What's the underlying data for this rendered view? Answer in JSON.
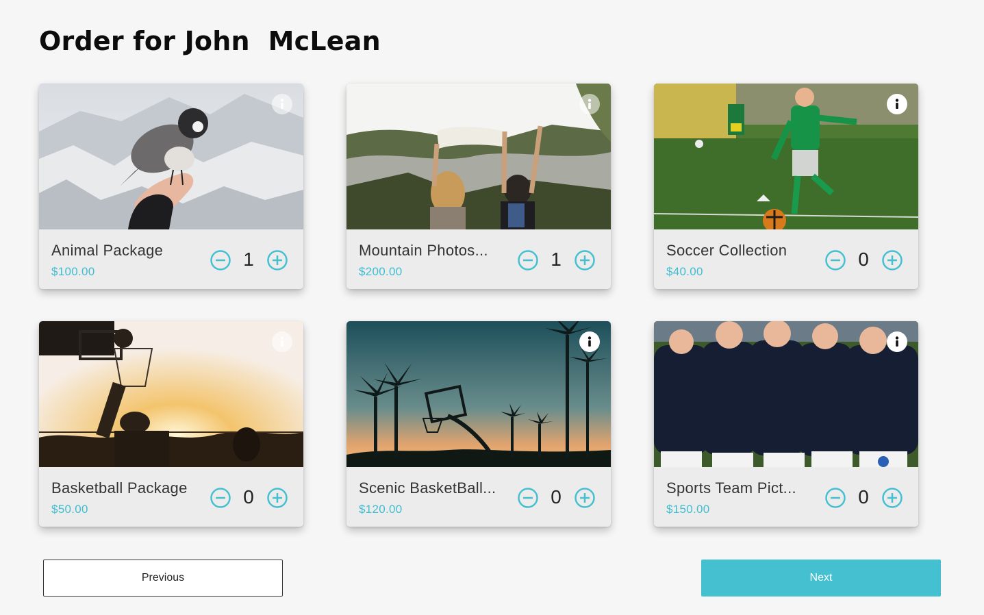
{
  "page": {
    "title": "Order for John  McLean"
  },
  "accent_color": "#44c0d1",
  "products": [
    {
      "name": "Animal Package",
      "price": "$100.00",
      "quantity": "1",
      "info_icon": "info-icon",
      "image": "bird-on-hand-snowy-mountain"
    },
    {
      "name": "Mountain Photos...",
      "price": "$200.00",
      "quantity": "1",
      "info_icon": "info-icon",
      "image": "two-girls-cliffs"
    },
    {
      "name": "Soccer Collection",
      "price": "$40.00",
      "quantity": "0",
      "info_icon": "info-icon",
      "image": "boy-kicking-soccer-ball"
    },
    {
      "name": "Basketball Package",
      "price": "$50.00",
      "quantity": "0",
      "info_icon": "info-icon",
      "image": "basketball-dunk-sunset"
    },
    {
      "name": "Scenic BasketBall...",
      "price": "$120.00",
      "quantity": "0",
      "info_icon": "info-icon",
      "image": "basketball-hoop-palm-trees"
    },
    {
      "name": "Sports Team Pict...",
      "price": "$150.00",
      "quantity": "0",
      "info_icon": "info-icon",
      "image": "soccer-team-kids"
    }
  ],
  "navigation": {
    "previous_label": "Previous",
    "next_label": "Next"
  }
}
